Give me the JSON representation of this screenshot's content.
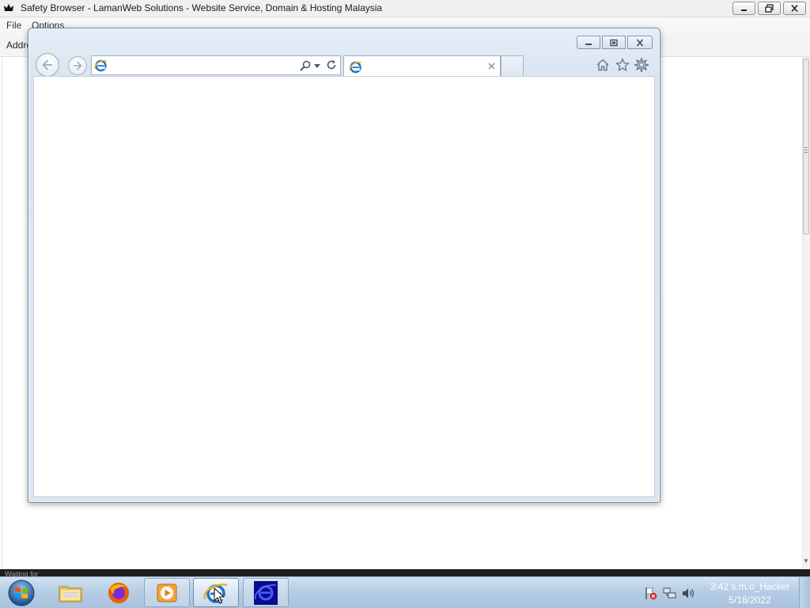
{
  "background_window": {
    "title": "Safety Browser - LamanWeb Solutions - Website Service, Domain & Hosting Malaysia",
    "app_icon": "crown-icon",
    "controls": [
      "minimize-icon",
      "maximize-icon",
      "close-icon"
    ],
    "menu": {
      "file": "File",
      "options": "Options"
    },
    "address_label": "Addre",
    "status_text": "Waiting for"
  },
  "ie_window": {
    "controls": [
      "minimize-icon",
      "restore-icon",
      "close-icon"
    ],
    "nav": {
      "back_icon": "back-arrow-icon",
      "forward_icon": "forward-arrow-icon"
    },
    "address": {
      "value": "",
      "page_icon": "ie-logo-icon",
      "search_icon": "search-icon",
      "dropdown_icon": "chevron-down-icon",
      "refresh_icon": "refresh-icon"
    },
    "tab": {
      "title": "",
      "icon": "ie-logo-icon",
      "close_icon": "close-icon"
    },
    "toolbar_icons": [
      "home-icon",
      "star-icon",
      "gear-icon"
    ]
  },
  "taskbar": {
    "start_icon": "windows-orb-icon",
    "pinned": [
      "folder-icon",
      "firefox-icon",
      "media-player-icon",
      "internet-explorer-icon",
      "blue-app-icon"
    ],
    "active_item": "internet-explorer-icon",
    "tray_icons": [
      "action-center-flag-icon",
      "network-icon",
      "volume-icon"
    ],
    "clock": {
      "time": "3:42 s.m.o_Hacker",
      "date": "5/18/2022"
    }
  },
  "colors": {
    "taskbar": "#b6cde4",
    "ie_frame": "#dae5f2",
    "ie_logo_blue": "#1e73c8",
    "ie_logo_gold": "#e8b51a"
  }
}
